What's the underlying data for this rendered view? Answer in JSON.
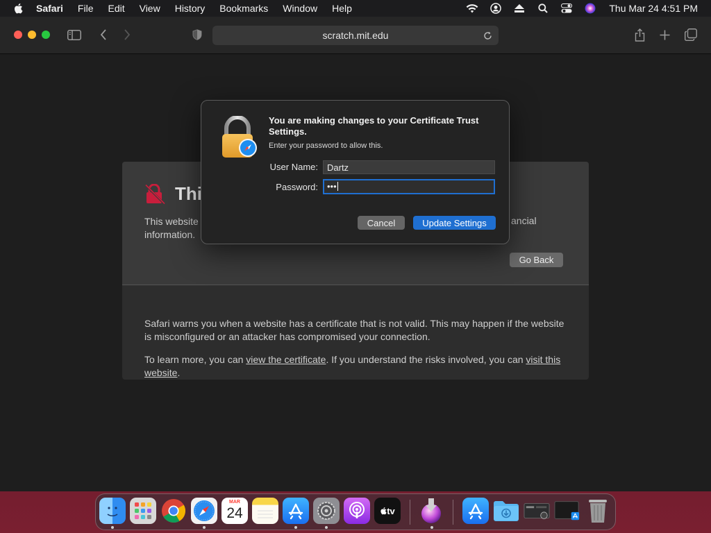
{
  "menubar": {
    "app_name": "Safari",
    "items": [
      "File",
      "Edit",
      "View",
      "History",
      "Bookmarks",
      "Window",
      "Help"
    ],
    "status_icons": [
      "wifi-icon",
      "user-icon",
      "eject-icon",
      "search-icon",
      "control-center-icon",
      "siri-icon"
    ],
    "clock": "Thu Mar 24  4:51 PM"
  },
  "browser": {
    "url": "scratch.mit.edu"
  },
  "warning_page": {
    "title_visible": "Thi",
    "text_left": "This website",
    "text_right": "ancial",
    "text_line2": "information.",
    "go_back_label": "Go Back",
    "info_paragraph_1": "Safari warns you when a website has a certificate that is not valid. This may happen if the website is misconfigured or an attacker has compromised your connection.",
    "info_p2_prefix": "To learn more, you can ",
    "info_p2_link1": "view the certificate",
    "info_p2_middle": ". If you understand the risks involved, you can ",
    "info_p2_link2": "visit this website",
    "info_p2_suffix": "."
  },
  "dialog": {
    "title": "You are making changes to your Certificate Trust Settings.",
    "subtitle": "Enter your password to allow this.",
    "username_label": "User Name:",
    "username_value": "Dartz",
    "password_label": "Password:",
    "password_value": "•••",
    "cancel_label": "Cancel",
    "update_label": "Update Settings"
  },
  "dock": {
    "apps": [
      "Finder",
      "Launchpad",
      "Chrome",
      "Safari",
      "Calendar",
      "Notes",
      "App Store",
      "System Preferences",
      "Podcasts",
      "TV",
      "Downloads-installer",
      "App Store",
      "Downloads",
      "Screenshot",
      "Preview",
      "Trash"
    ],
    "calendar_month": "MAR",
    "calendar_day": "24",
    "tv_label": "tv"
  }
}
